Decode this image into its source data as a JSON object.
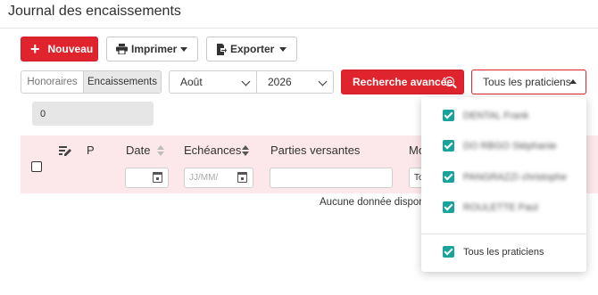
{
  "header": {
    "title": "Journal des encaissements"
  },
  "toolbar": {
    "new_label": "Nouveau",
    "print_label": "Imprimer",
    "export_label": "Exporter"
  },
  "filters": {
    "segment": [
      "Honoraires",
      "Encaissements"
    ],
    "month": "Août",
    "year": "2026",
    "advanced_search": "Recherche avancée",
    "practitioners": "Tous les praticiens"
  },
  "summary": {
    "count": "0"
  },
  "table": {
    "headers": {
      "p": "P",
      "date": "Date",
      "echeances": "Echéances",
      "parties": "Parties versantes",
      "mo": "Mo"
    },
    "date_placeholder": "JJ/MM/",
    "mo_value": "To",
    "empty": "Aucune donnée dispon"
  },
  "dropdown": {
    "items": [
      "DENTAL Frank",
      "DO RBGO Stéphanie",
      "PANGRAZZI christophe",
      "ROULETTE Paul"
    ],
    "all_label": "Tous les praticiens"
  },
  "colors": {
    "accent": "#e0242d",
    "check": "#1aa39a",
    "header_bg": "#fce8ea"
  }
}
